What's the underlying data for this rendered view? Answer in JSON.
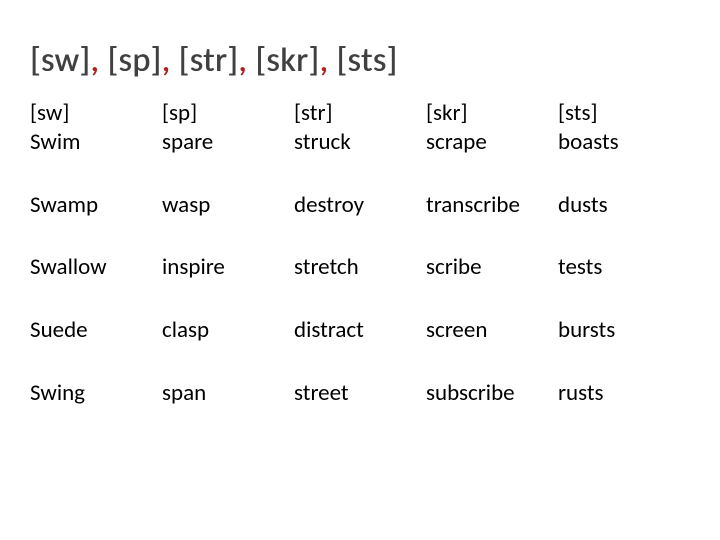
{
  "title": {
    "segments": [
      "[sw]",
      "[sp]",
      "[str]",
      "[skr]",
      "[sts]"
    ],
    "separator": ","
  },
  "table": {
    "columns": [
      {
        "header": "[sw]",
        "first": "Swim",
        "rest": [
          "Swamp",
          "Swallow",
          "Suede",
          "Swing"
        ]
      },
      {
        "header": "[sp]",
        "first": "spare",
        "rest": [
          "wasp",
          "inspire",
          "clasp",
          "span"
        ]
      },
      {
        "header": "[str]",
        "first": "struck",
        "rest": [
          "destroy",
          "stretch",
          "distract",
          "street"
        ]
      },
      {
        "header": "[skr]",
        "first": "scrape",
        "rest": [
          "transcribe",
          "scribe",
          "screen",
          "subscribe"
        ]
      },
      {
        "header": "[sts]",
        "first": "boasts",
        "rest": [
          "dusts",
          "tests",
          "bursts",
          "rusts"
        ]
      }
    ]
  }
}
